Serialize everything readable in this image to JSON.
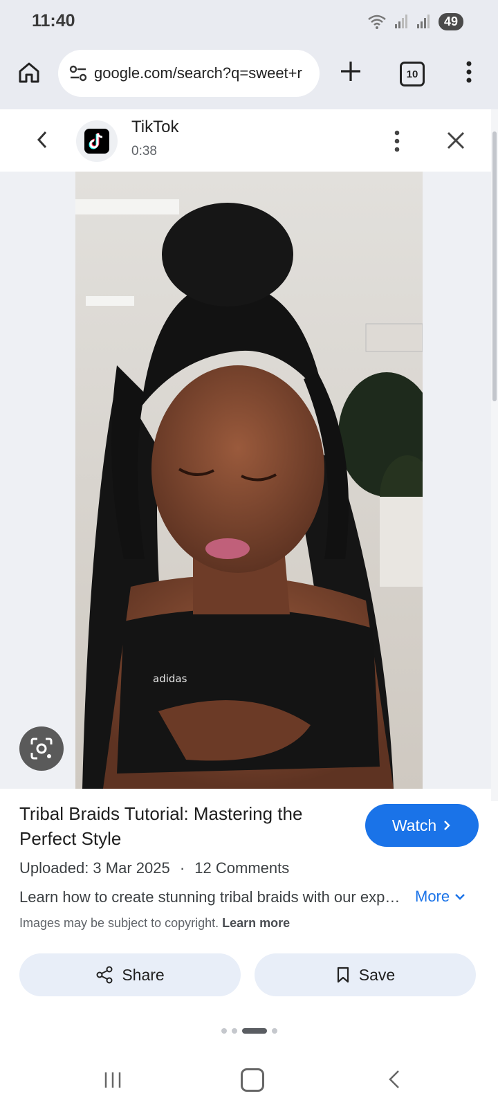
{
  "status_bar": {
    "time": "11:40",
    "battery": "49"
  },
  "browser": {
    "url": "google.com/search?q=sweet+r",
    "tab_count": "10"
  },
  "panel": {
    "source_name": "TikTok",
    "duration": "0:38"
  },
  "result": {
    "title": "Tribal Braids Tutorial: Mastering the Perfect Style",
    "watch_label": "Watch",
    "uploaded": "Uploaded: 3 Mar 2025",
    "separator": "·",
    "comments": "12 Comments",
    "description": "Learn how to create stunning tribal braids with our expert tutorial.",
    "more_label": "More",
    "copyright_text": "Images may be subject to copyright.",
    "learn_more_label": "Learn more",
    "share_label": "Share",
    "save_label": "Save"
  },
  "carousel": {
    "current_index": 3,
    "total": 4
  },
  "colors": {
    "accent": "#1a73e8",
    "chrome_bg": "#e9ebf1",
    "button_bg": "#e8eef8"
  },
  "icons": {
    "home": "home-icon",
    "tune": "tune-icon",
    "plus": "plus-icon",
    "menu": "more-vert-icon",
    "back": "chevron-left-icon",
    "close": "close-icon",
    "lens": "google-lens-icon",
    "share": "share-icon",
    "save": "bookmark-icon"
  }
}
